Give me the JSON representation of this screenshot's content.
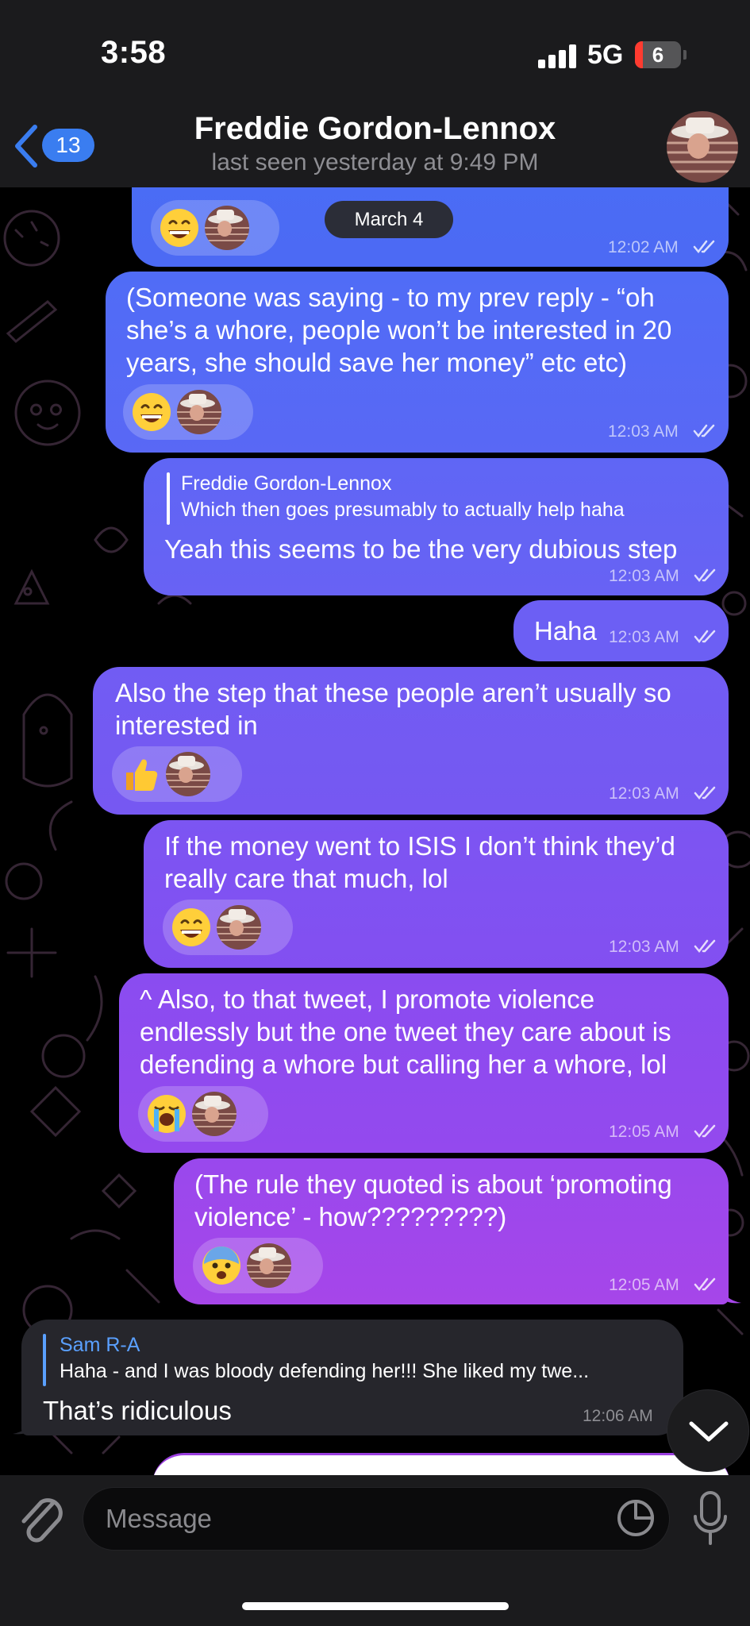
{
  "status_bar": {
    "time": "3:58",
    "network": "5G",
    "battery": "6"
  },
  "header": {
    "back_count": "13",
    "title": "Freddie Gordon-Lennox",
    "subtitle": "last seen yesterday at 9:49 PM"
  },
  "date_pill": "March 4",
  "messages": [
    {
      "id": "m1",
      "direction": "outgoing",
      "text": [],
      "reaction": "grinning-face",
      "time": "12:02 AM",
      "read": true
    },
    {
      "id": "m2",
      "direction": "outgoing",
      "text": [
        "(Someone was saying - to my prev reply - “oh",
        "she’s a whore, people won’t be interested in 20",
        "years, she should save her money” etc etc)"
      ],
      "reaction": "grinning-face",
      "time": "12:03 AM",
      "read": true
    },
    {
      "id": "m3",
      "direction": "outgoing",
      "reply": {
        "name": "Freddie Gordon-Lennox",
        "text": "Which then goes presumably to actually help haha"
      },
      "text": [
        "Yeah this seems to be the very dubious step"
      ],
      "time": "12:03 AM",
      "read": true
    },
    {
      "id": "m4",
      "direction": "outgoing",
      "text": [
        "Haha"
      ],
      "time": "12:03 AM",
      "read": true
    },
    {
      "id": "m5",
      "direction": "outgoing",
      "text": [
        "Also the step that these people aren’t usually so",
        "interested in"
      ],
      "reaction": "thumbs-up",
      "time": "12:03 AM",
      "read": true
    },
    {
      "id": "m6",
      "direction": "outgoing",
      "text": [
        "If the money went to ISIS I don’t think they’d",
        "really care that much, lol"
      ],
      "reaction": "grinning-face",
      "time": "12:03 AM",
      "read": true
    },
    {
      "id": "m7",
      "direction": "outgoing",
      "text": [
        "^ Also, to that tweet, I promote violence",
        "endlessly but the one tweet they care about is",
        "defending a whore but calling her a whore, lol"
      ],
      "reaction": "loudly-crying-face",
      "time": "12:05 AM",
      "read": true
    },
    {
      "id": "m8",
      "direction": "outgoing",
      "text": [
        "(The rule they quoted is about ‘promoting",
        "violence’ - how?????????)"
      ],
      "reaction": "fearful-face",
      "time": "12:05 AM",
      "read": true
    },
    {
      "id": "m9",
      "direction": "incoming",
      "reply": {
        "name": "Sam R-A",
        "text": "Haha - and I was bloody defending her!!! She liked my twe..."
      },
      "text": [
        "That’s ridiculous"
      ],
      "time": "12:06 AM"
    }
  ],
  "composer": {
    "placeholder": "Message"
  },
  "colors": {
    "bubble_top": "#4a6cf5",
    "bubble_mid": "#7a4ef2",
    "bubble_bottom": "#a547e8",
    "incoming_bubble": "#26262c",
    "accent_blue": "#3a7df0",
    "reply_name_incoming": "#5aa0ff"
  }
}
